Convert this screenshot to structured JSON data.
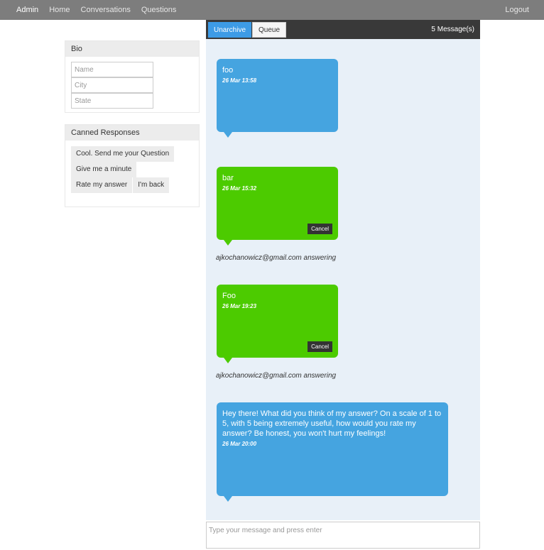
{
  "navbar": {
    "brand": "Admin",
    "links": [
      "Home",
      "Conversations",
      "Questions"
    ],
    "logout": "Logout"
  },
  "bio": {
    "heading": "Bio",
    "name_placeholder": "Name",
    "city_placeholder": "City",
    "state_placeholder": "State"
  },
  "canned": {
    "heading": "Canned Responses",
    "items": [
      "Cool. Send me your Question",
      "Give me a minute",
      "Rate my answer",
      "I'm back"
    ]
  },
  "toolbar": {
    "unarchive_label": "Unarchive",
    "queue_label": "Queue",
    "message_count": "5 Message(s)"
  },
  "messages": [
    {
      "text": "foo",
      "time": "26 Mar 13:58",
      "color": "#45a4e0"
    },
    {
      "text": "bar",
      "time": "26 Mar 15:32",
      "color": "#4ccb00",
      "cancel": "Cancel"
    },
    {
      "answering": "ajkochanowicz@gmail.com answering"
    },
    {
      "text": "Foo",
      "time": "26 Mar 19:23",
      "color": "#4ccb00",
      "cancel": "Cancel"
    },
    {
      "answering": "ajkochanowicz@gmail.com answering"
    },
    {
      "text": "Hey there! What did you think of my answer? On a scale of 1 to 5, with 5 being extremely useful, how would you rate my answer? Be honest, you won't hurt my feelings!",
      "time": "26 Mar 20:00",
      "color": "#45a4e0"
    }
  ],
  "composer": {
    "placeholder": "Type your message and press enter"
  }
}
